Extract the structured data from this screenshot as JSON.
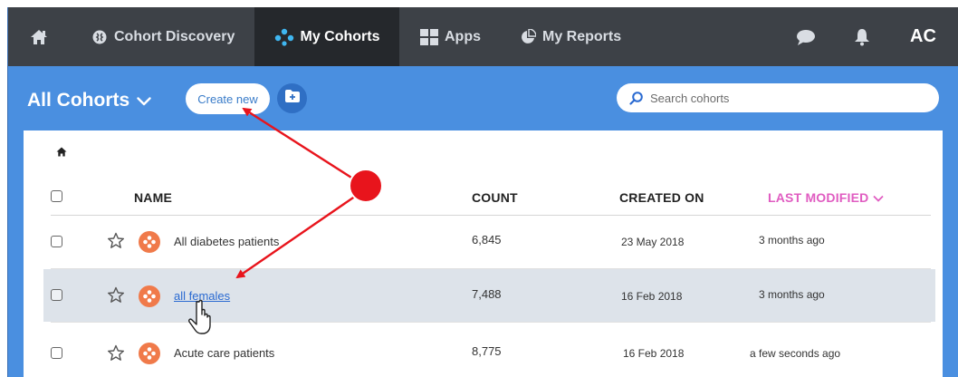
{
  "nav": {
    "items": [
      {
        "label": "",
        "icon": "home-icon"
      },
      {
        "label": "Cohort Discovery",
        "icon": "brain-icon"
      },
      {
        "label": "My Cohorts",
        "icon": "cohort-icon"
      },
      {
        "label": "Apps",
        "icon": "grid-icon"
      },
      {
        "label": "My Reports",
        "icon": "pie-chart-icon"
      }
    ],
    "active": "My Cohorts",
    "user_initials": "AC"
  },
  "toolbar": {
    "title": "All Cohorts",
    "create_label": "Create new",
    "search_placeholder": "Search cohorts"
  },
  "table": {
    "columns": {
      "name": "NAME",
      "count": "COUNT",
      "created": "CREATED ON",
      "modified": "LAST MODIFIED"
    },
    "rows": [
      {
        "name": "All diabetes patients",
        "count": "6,845",
        "created": "23 May 2018",
        "modified": "3 months ago",
        "highlighted": false,
        "linked": false
      },
      {
        "name": "all females",
        "count": "7,488",
        "created": "16 Feb 2018",
        "modified": "3 months ago",
        "highlighted": true,
        "linked": true
      },
      {
        "name": "Acute care patients",
        "count": "8,775",
        "created": "16 Feb 2018",
        "modified": "a few seconds ago",
        "highlighted": false,
        "linked": false
      }
    ]
  },
  "colors": {
    "nav_bg": "#3d4147",
    "toolbar_bg": "#4a8fe0",
    "sort_accent": "#e05cc1",
    "cohort_icon": "#f07a4a",
    "annotation": "#e8141c"
  }
}
